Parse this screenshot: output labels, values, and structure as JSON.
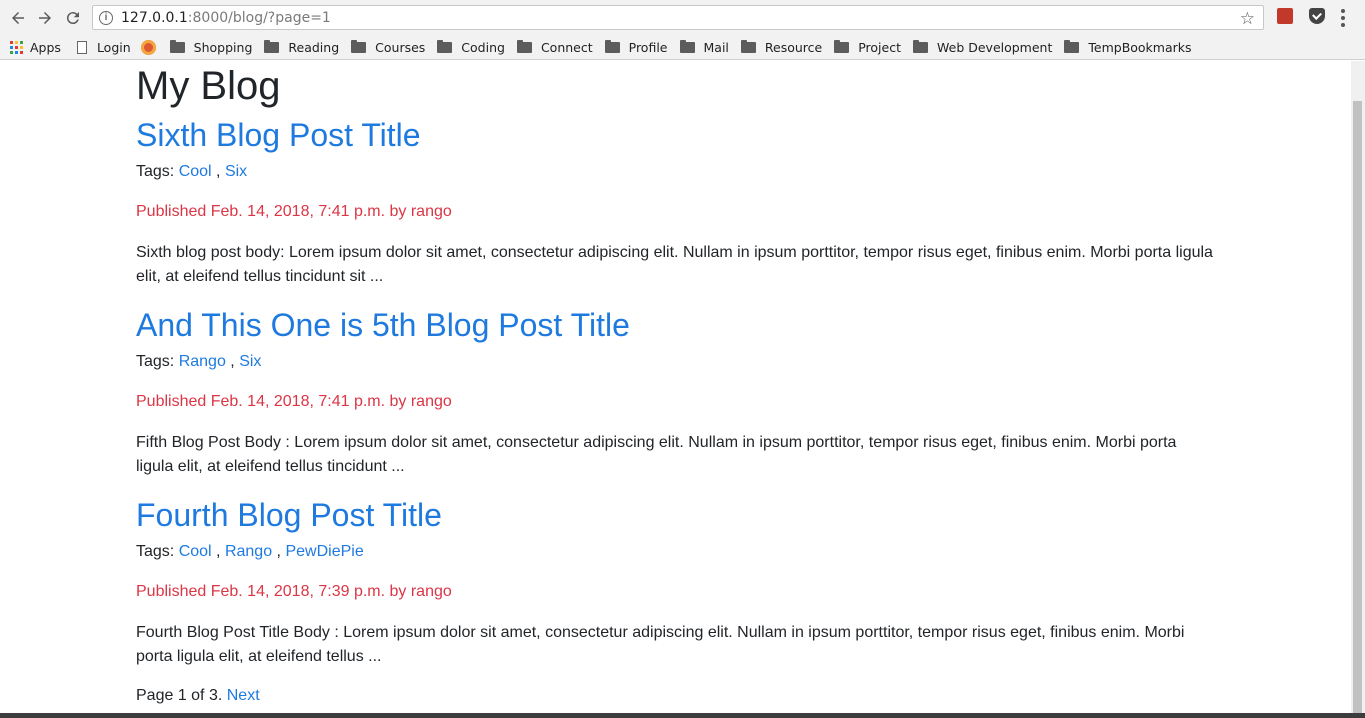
{
  "browser": {
    "url_host": "127.0.0.1",
    "url_rest": ":8000/blog/?page=1",
    "bookmarks": [
      {
        "label": "Apps",
        "icon": "apps-icon"
      },
      {
        "label": "Login",
        "icon": "page-icon"
      },
      {
        "label": "",
        "icon": "duckduckgo-icon"
      },
      {
        "label": "Shopping",
        "icon": "folder-icon"
      },
      {
        "label": "Reading",
        "icon": "folder-icon"
      },
      {
        "label": "Courses",
        "icon": "folder-icon"
      },
      {
        "label": "Coding",
        "icon": "folder-icon"
      },
      {
        "label": "Connect",
        "icon": "folder-icon"
      },
      {
        "label": "Profile",
        "icon": "folder-icon"
      },
      {
        "label": "Mail",
        "icon": "folder-icon"
      },
      {
        "label": "Resource",
        "icon": "folder-icon"
      },
      {
        "label": "Project",
        "icon": "folder-icon"
      },
      {
        "label": "Web Development",
        "icon": "folder-icon"
      },
      {
        "label": "TempBookmarks",
        "icon": "folder-icon"
      }
    ]
  },
  "page": {
    "title": "My Blog",
    "tags_prefix": "Tags:",
    "posts": [
      {
        "title": "Sixth Blog Post Title",
        "tags": [
          "Cool",
          "Six"
        ],
        "published": "Published Feb. 14, 2018, 7:41 p.m. by rango",
        "body": "Sixth blog post body: Lorem ipsum dolor sit amet, consectetur adipiscing elit. Nullam in ipsum porttitor, tempor risus eget, finibus enim. Morbi porta ligula elit, at eleifend tellus tincidunt sit ..."
      },
      {
        "title": "And This One is 5th Blog Post Title",
        "tags": [
          "Rango",
          "Six"
        ],
        "published": "Published Feb. 14, 2018, 7:41 p.m. by rango",
        "body": "Fifth Blog Post Body : Lorem ipsum dolor sit amet, consectetur adipiscing elit. Nullam in ipsum porttitor, tempor risus eget, finibus enim. Morbi porta ligula elit, at eleifend tellus tincidunt ..."
      },
      {
        "title": "Fourth Blog Post Title",
        "tags": [
          "Cool",
          "Rango",
          "PewDiePie"
        ],
        "published": "Published Feb. 14, 2018, 7:39 p.m. by rango",
        "body": "Fourth Blog Post Title Body : Lorem ipsum dolor sit amet, consectetur adipiscing elit. Nullam in ipsum porttitor, tempor risus eget, finibus enim. Morbi porta ligula elit, at eleifend tellus ..."
      }
    ],
    "pagination": {
      "status": "Page 1 of 3.",
      "next_label": "Next"
    }
  },
  "colors": {
    "link": "#1f7ae0",
    "published": "#dc3545",
    "text": "#212529"
  }
}
